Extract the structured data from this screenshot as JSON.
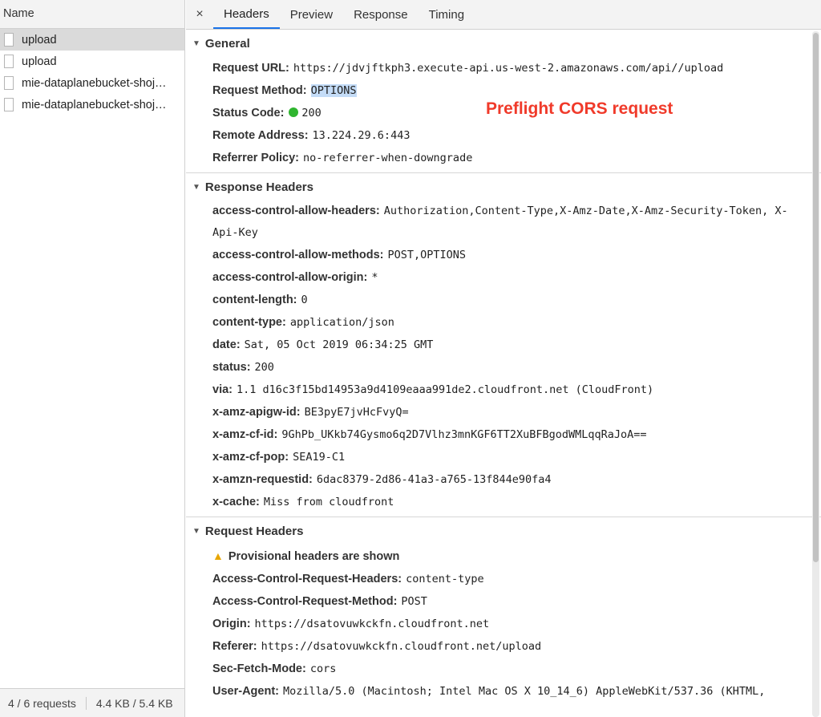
{
  "left": {
    "header": "Name",
    "requests": [
      {
        "name": "upload",
        "selected": true
      },
      {
        "name": "upload",
        "selected": false
      },
      {
        "name": "mie-dataplanebucket-shoj…",
        "selected": false
      },
      {
        "name": "mie-dataplanebucket-shoj…",
        "selected": false
      }
    ],
    "footer": {
      "count": "4 / 6 requests",
      "size": "4.4 KB / 5.4 KB"
    }
  },
  "tabs": {
    "close": "×",
    "items": [
      "Headers",
      "Preview",
      "Response",
      "Timing"
    ],
    "active": "Headers"
  },
  "annotation": "Preflight CORS request",
  "general": {
    "title": "General",
    "rows": [
      {
        "k": "Request URL:",
        "v": "https://jdvjftkph3.execute-api.us-west-2.amazonaws.com/api//upload"
      },
      {
        "k": "Request Method:",
        "v": "OPTIONS"
      },
      {
        "k": "Status Code:",
        "v": "200"
      },
      {
        "k": "Remote Address:",
        "v": "13.224.29.6:443"
      },
      {
        "k": "Referrer Policy:",
        "v": "no-referrer-when-downgrade"
      }
    ]
  },
  "response_headers": {
    "title": "Response Headers",
    "rows": [
      {
        "k": "access-control-allow-headers:",
        "v": "Authorization,Content-Type,X-Amz-Date,X-Amz-Security-Token, X-Api-Key"
      },
      {
        "k": "access-control-allow-methods:",
        "v": "POST,OPTIONS"
      },
      {
        "k": "access-control-allow-origin:",
        "v": "*"
      },
      {
        "k": "content-length:",
        "v": "0"
      },
      {
        "k": "content-type:",
        "v": "application/json"
      },
      {
        "k": "date:",
        "v": "Sat, 05 Oct 2019 06:34:25 GMT"
      },
      {
        "k": "status:",
        "v": "200"
      },
      {
        "k": "via:",
        "v": "1.1 d16c3f15bd14953a9d4109eaaa991de2.cloudfront.net (CloudFront)"
      },
      {
        "k": "x-amz-apigw-id:",
        "v": "BE3pyE7jvHcFvyQ="
      },
      {
        "k": "x-amz-cf-id:",
        "v": "9GhPb_UKkb74Gysmo6q2D7Vlhz3mnKGF6TT2XuBFBgodWMLqqRaJoA=="
      },
      {
        "k": "x-amz-cf-pop:",
        "v": "SEA19-C1"
      },
      {
        "k": "x-amzn-requestid:",
        "v": "6dac8379-2d86-41a3-a765-13f844e90fa4"
      },
      {
        "k": "x-cache:",
        "v": "Miss from cloudfront"
      }
    ]
  },
  "request_headers": {
    "title": "Request Headers",
    "warning": "Provisional headers are shown",
    "rows": [
      {
        "k": "Access-Control-Request-Headers:",
        "v": "content-type"
      },
      {
        "k": "Access-Control-Request-Method:",
        "v": "POST"
      },
      {
        "k": "Origin:",
        "v": "https://dsatovuwkckfn.cloudfront.net"
      },
      {
        "k": "Referer:",
        "v": "https://dsatovuwkckfn.cloudfront.net/upload"
      },
      {
        "k": "Sec-Fetch-Mode:",
        "v": "cors"
      },
      {
        "k": "User-Agent:",
        "v": "Mozilla/5.0 (Macintosh; Intel Mac OS X 10_14_6) AppleWebKit/537.36 (KHTML,"
      }
    ]
  },
  "colors": {
    "accent": "#1a73e8",
    "annotation": "#f03a2a",
    "status_ok": "#2fb52f",
    "highlight": "#c4dcf7"
  }
}
